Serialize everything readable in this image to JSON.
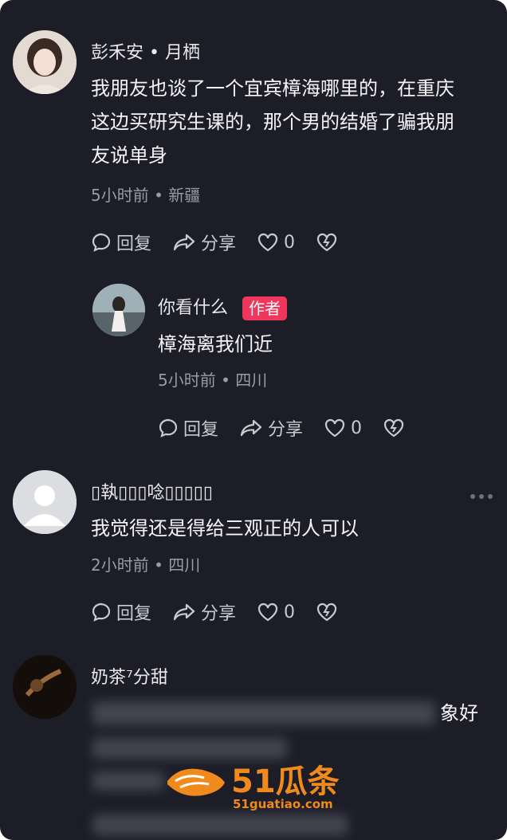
{
  "comments": [
    {
      "user": "彭禾安 • 月栖",
      "text_lines": [
        "我朋友也谈了一个宜宾樟海哪里的，在重庆",
        "这边买研究生课的，那个男的结婚了骗我朋",
        "友说单身"
      ],
      "meta": "5小时前 • 新疆",
      "reply_label": "回复",
      "share_label": "分享",
      "likes": "0"
    },
    {
      "user": "你看什么",
      "badge": "作者",
      "text": "樟海离我们近",
      "meta": "5小时前 • 四川",
      "reply_label": "回复",
      "share_label": "分享",
      "likes": "0"
    },
    {
      "user": "▯執▯▯▯唸▯▯▯▯▯",
      "text": "我觉得还是得给三观正的人可以",
      "meta": "2小时前 • 四川",
      "reply_label": "回复",
      "share_label": "分享",
      "likes": "0"
    },
    {
      "user": "奶茶⁷分甜",
      "text_visible_tail": "象好"
    }
  ],
  "watermark": {
    "brand": "51瓜条",
    "url": "51guatiao.com",
    "color": "#f08a1c"
  },
  "colors": {
    "background": "#1c1d27",
    "badge": "#f0365c"
  }
}
